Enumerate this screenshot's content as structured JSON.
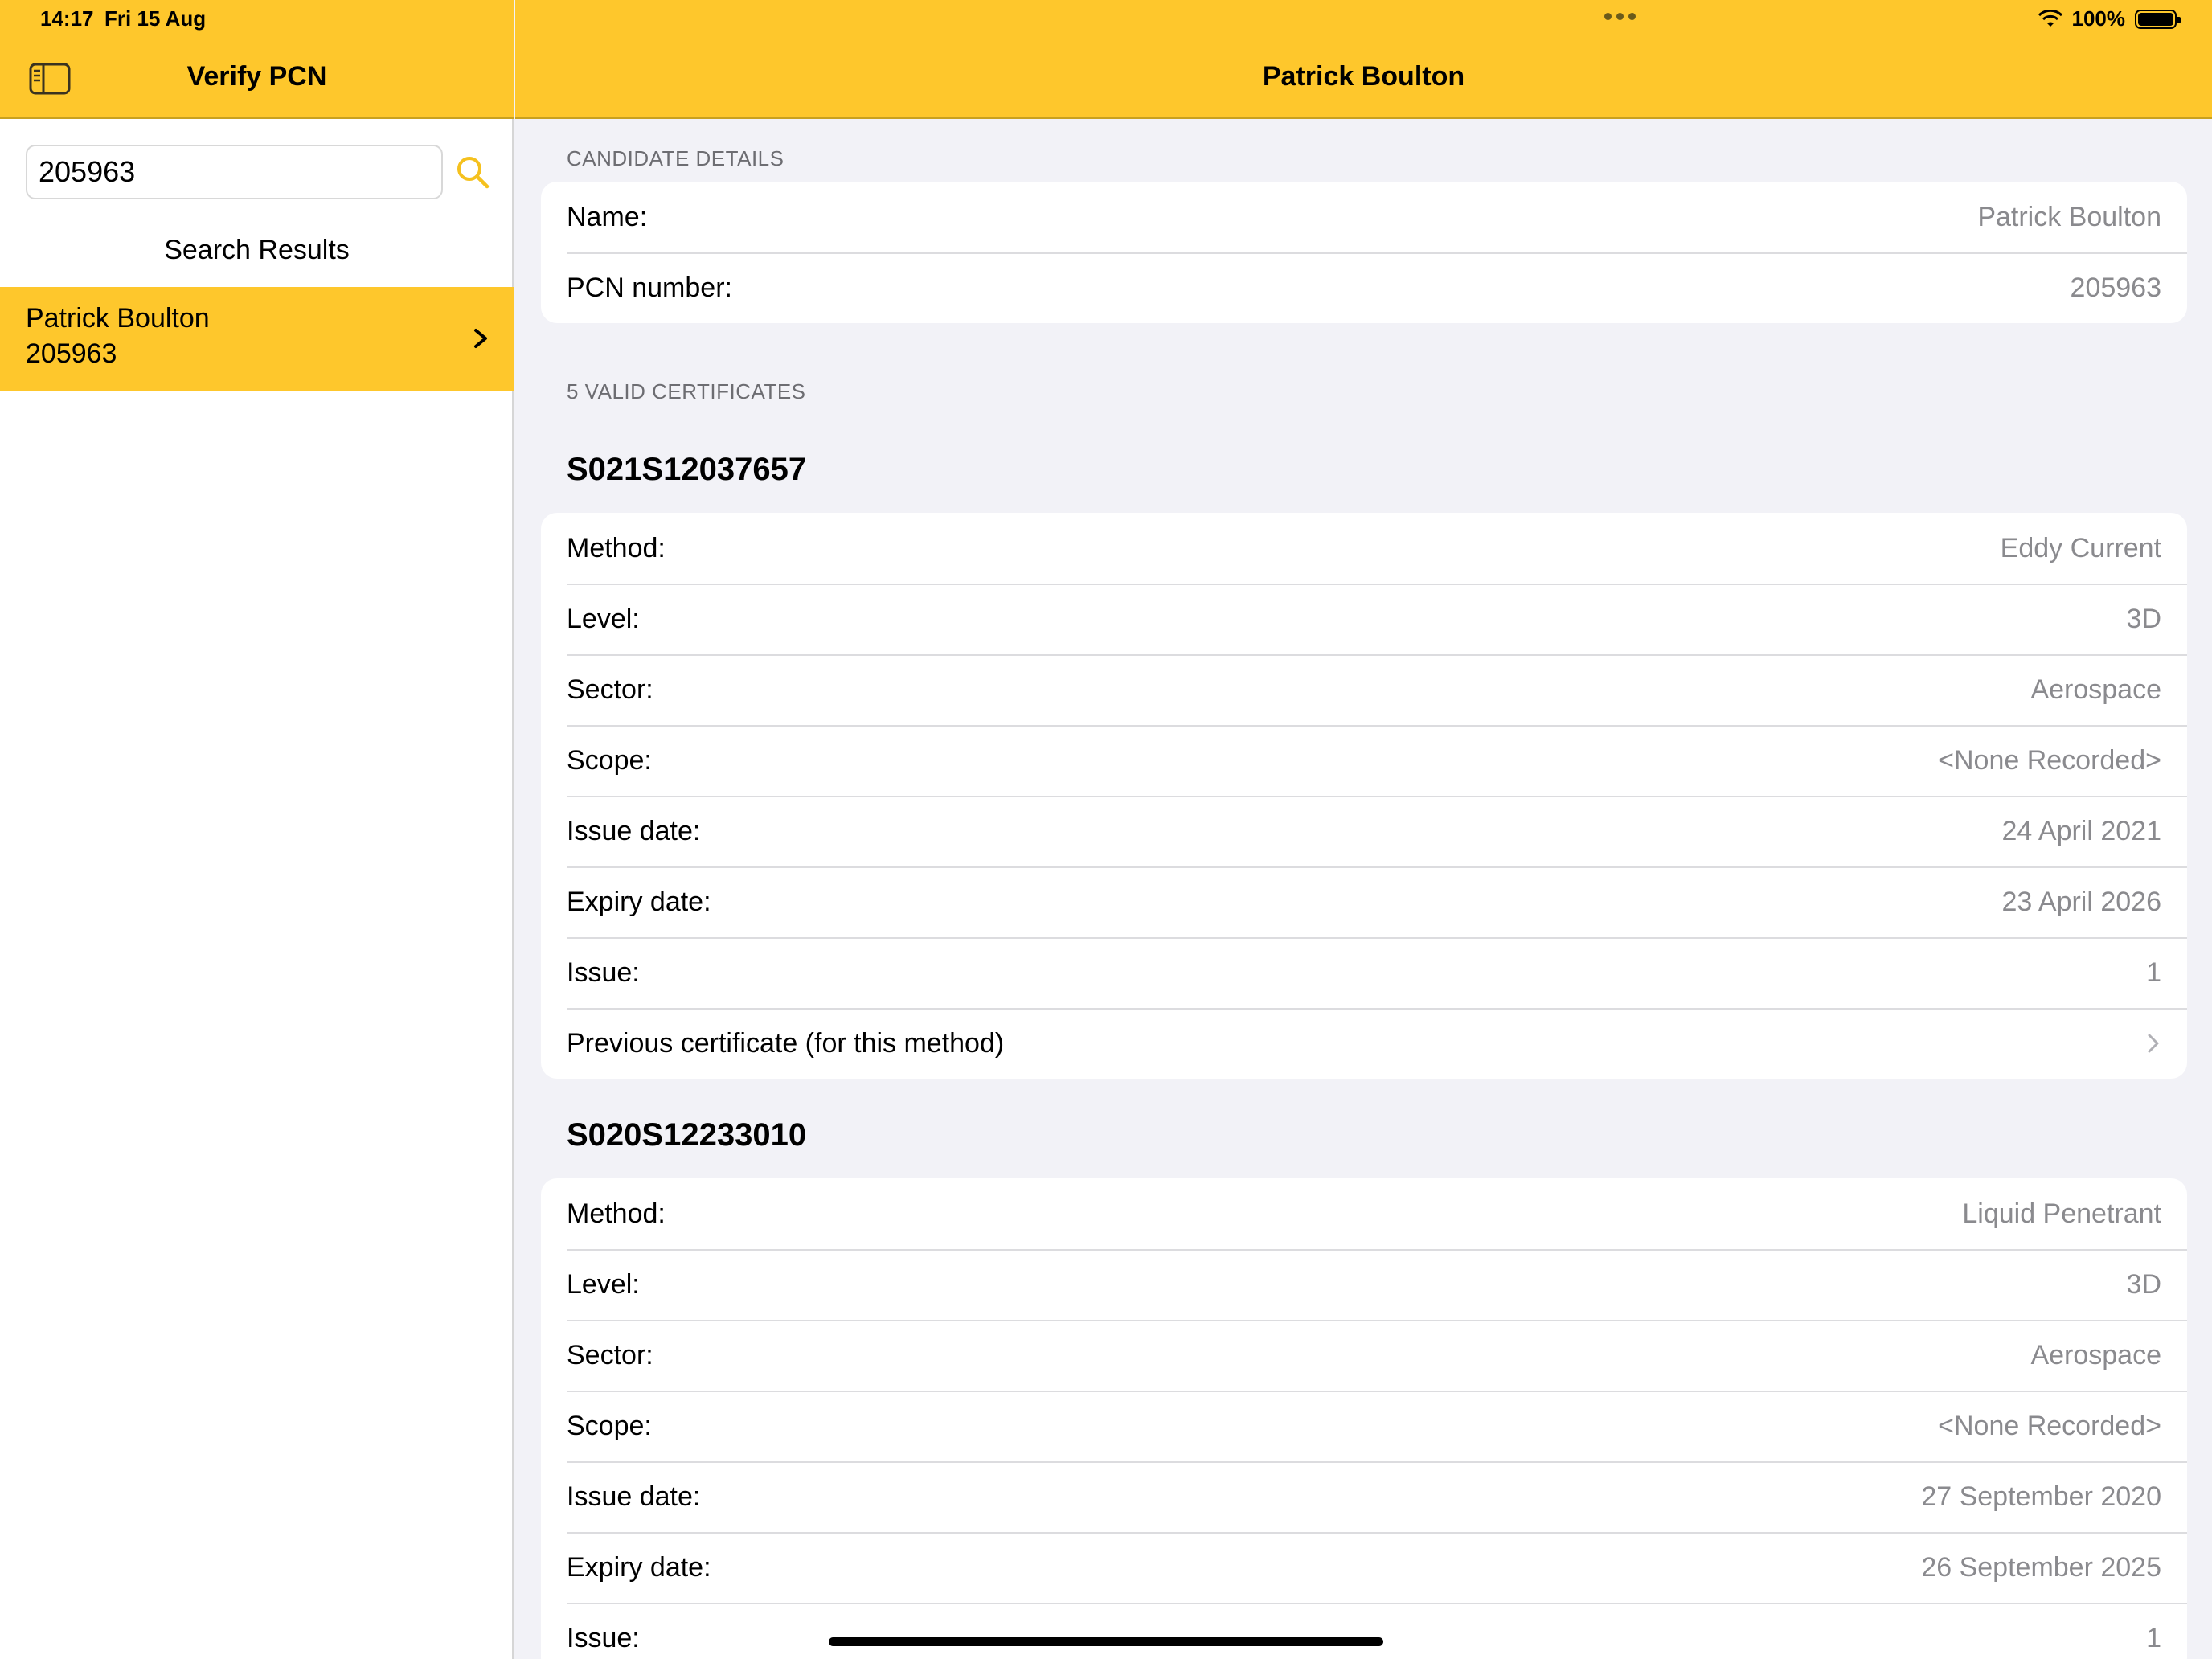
{
  "status_bar": {
    "time": "14:17",
    "date": "Fri 15 Aug",
    "battery": "100%"
  },
  "sidebar": {
    "title": "Verify PCN",
    "search_value": "205963",
    "results_label": "Search Results",
    "results": [
      {
        "name": "Patrick Boulton",
        "number": "205963"
      }
    ]
  },
  "main": {
    "title": "Patrick Boulton",
    "candidate_section": "CANDIDATE DETAILS",
    "candidate": [
      {
        "label": "Name:",
        "value": "Patrick Boulton"
      },
      {
        "label": "PCN number:",
        "value": "205963"
      }
    ],
    "certs_section": "5 VALID CERTIFICATES",
    "certificates": [
      {
        "id": "S021S12037657",
        "rows": [
          {
            "label": "Method:",
            "value": "Eddy Current"
          },
          {
            "label": "Level:",
            "value": "3D"
          },
          {
            "label": "Sector:",
            "value": "Aerospace"
          },
          {
            "label": "Scope:",
            "value": "<None Recorded>"
          },
          {
            "label": "Issue date:",
            "value": "24 April 2021"
          },
          {
            "label": "Expiry date:",
            "value": "23 April 2026"
          },
          {
            "label": "Issue:",
            "value": "1"
          }
        ],
        "previous_label": "Previous certificate (for this method)"
      },
      {
        "id": "S020S12233010",
        "rows": [
          {
            "label": "Method:",
            "value": "Liquid Penetrant"
          },
          {
            "label": "Level:",
            "value": "3D"
          },
          {
            "label": "Sector:",
            "value": "Aerospace"
          },
          {
            "label": "Scope:",
            "value": "<None Recorded>"
          },
          {
            "label": "Issue date:",
            "value": "27 September 2020"
          },
          {
            "label": "Expiry date:",
            "value": "26 September 2025"
          },
          {
            "label": "Issue:",
            "value": "1"
          }
        ]
      }
    ]
  },
  "colors": {
    "accent": "#fec72c",
    "background": "#f2f2f7",
    "secondary_text": "#8a8a8e"
  },
  "icons": {
    "sidebar_toggle": "sidebar-icon",
    "search": "magnifier-icon",
    "chevron": "chevron-right-icon",
    "wifi": "wifi-icon",
    "battery": "battery-icon"
  }
}
